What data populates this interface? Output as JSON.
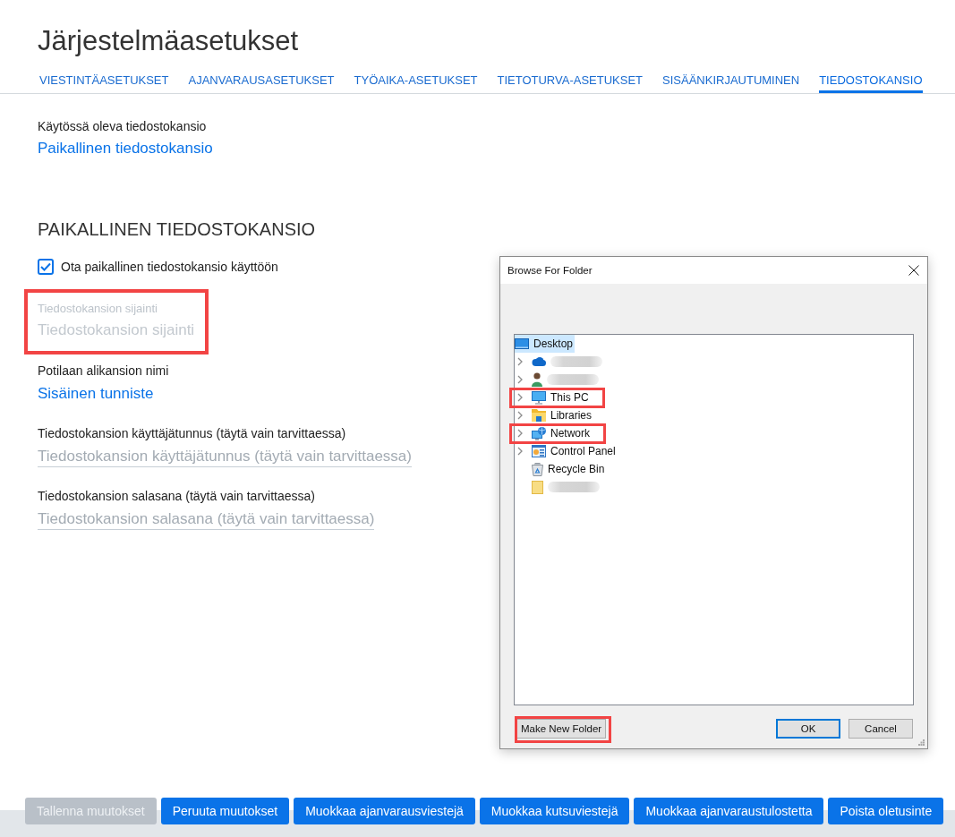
{
  "page": {
    "title": "Järjestelmäasetukset"
  },
  "tabs": [
    {
      "label": "VIESTINTÄASETUKSET",
      "selected": false
    },
    {
      "label": "AJANVARAUSASETUKSET",
      "selected": false
    },
    {
      "label": "TYÖAIKA-ASETUKSET",
      "selected": false
    },
    {
      "label": "TIETOTURVA-ASETUKSET",
      "selected": false
    },
    {
      "label": "SISÄÄNKIRJAUTUMINEN",
      "selected": false
    },
    {
      "label": "TIEDOSTOKANSIO",
      "selected": true
    }
  ],
  "current_folder": {
    "label": "Käytössä oleva tiedostokansio",
    "value": "Paikallinen tiedostokansio"
  },
  "local_folder": {
    "heading": "PAIKALLINEN TIEDOSTOKANSIO",
    "enable_checkbox": {
      "label": "Ota paikallinen tiedostokansio käyttöön",
      "checked": true
    },
    "fields": [
      {
        "kind": "input",
        "label": "Tiedostokansion sijainti",
        "placeholder": "Tiedostokansion sijainti",
        "disabled": true,
        "highlighted": true
      },
      {
        "kind": "select",
        "label": "Potilaan alikansion nimi",
        "value": "Sisäinen tunniste",
        "highlighted": false
      },
      {
        "kind": "input",
        "label": "Tiedostokansion käyttäjätunnus (täytä vain tarvittaessa)",
        "placeholder": "Tiedostokansion käyttäjätunnus (täytä vain tarvittaessa)",
        "disabled": false,
        "highlighted": false
      },
      {
        "kind": "input",
        "label": "Tiedostokansion salasana (täytä vain tarvittaessa)",
        "placeholder": "Tiedostokansion salasana (täytä vain tarvittaessa)",
        "disabled": false,
        "highlighted": false
      }
    ]
  },
  "dialog": {
    "title": "Browse For Folder",
    "tree": [
      {
        "kind": "desktop",
        "label": "Desktop",
        "redacted": false,
        "selected": true,
        "highlighted": false,
        "children": [
          {
            "kind": "cloud",
            "redacted": true,
            "expandable": true,
            "selected": false,
            "highlighted": false
          },
          {
            "kind": "user",
            "redacted": true,
            "expandable": true,
            "selected": false,
            "highlighted": false
          },
          {
            "kind": "computer",
            "label": "This PC",
            "redacted": false,
            "expandable": true,
            "selected": false,
            "highlighted": true
          },
          {
            "kind": "libraries",
            "label": "Libraries",
            "redacted": false,
            "expandable": true,
            "selected": false,
            "highlighted": false
          },
          {
            "kind": "network",
            "label": "Network",
            "redacted": false,
            "expandable": true,
            "selected": false,
            "highlighted": true
          },
          {
            "kind": "control-panel",
            "label": "Control Panel",
            "redacted": false,
            "expandable": true,
            "selected": false,
            "highlighted": false
          },
          {
            "kind": "recycle-bin",
            "label": "Recycle Bin",
            "redacted": false,
            "expandable": false,
            "selected": false,
            "highlighted": false
          },
          {
            "kind": "folder",
            "redacted": true,
            "expandable": false,
            "selected": false,
            "highlighted": false
          }
        ]
      }
    ],
    "buttons": [
      {
        "kind": "standard",
        "label": "Make New Folder",
        "highlighted": true
      },
      {
        "kind": "default",
        "label": "OK",
        "highlighted": false
      },
      {
        "kind": "standard",
        "label": "Cancel",
        "highlighted": false
      }
    ]
  },
  "footer_buttons": [
    {
      "label": "Tallenna muutokset",
      "disabled": true
    },
    {
      "label": "Peruuta muutokset",
      "disabled": false
    },
    {
      "label": "Muokkaa ajanvarausviestejä",
      "disabled": false
    },
    {
      "label": "Muokkaa kutsuviestejä",
      "disabled": false
    },
    {
      "label": "Muokkaa ajanvaraustulostetta",
      "disabled": false
    },
    {
      "label": "Poista oletusinte",
      "disabled": false
    }
  ]
}
